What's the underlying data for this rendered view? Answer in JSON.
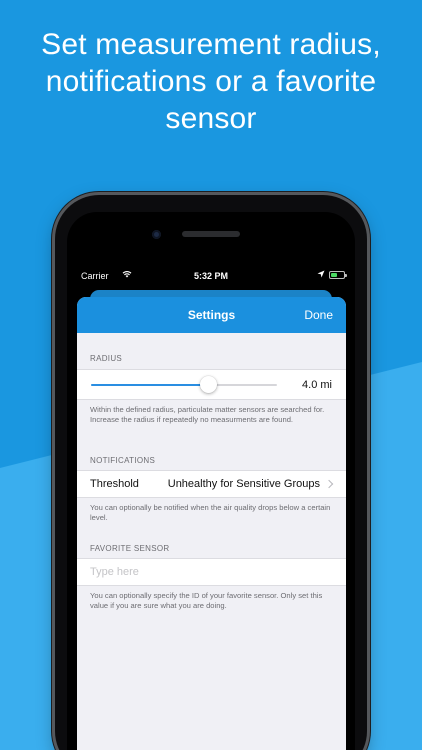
{
  "headline": {
    "line1": "Set measurement radius,",
    "line2": "notifications or a favorite",
    "line3": "sensor"
  },
  "status_bar": {
    "carrier": "Carrier",
    "time": "5:32 PM",
    "icons": [
      "wifi-icon",
      "location-icon",
      "battery-icon"
    ]
  },
  "navbar": {
    "title": "Settings",
    "done_label": "Done"
  },
  "radius": {
    "header": "RADIUS",
    "slider_fraction": 0.63,
    "value": "4.0 mi",
    "footer": "Within the defined radius, particulate matter sensors are searched for. Increase the radius if repeatedly no measurments are found."
  },
  "notifications": {
    "header": "NOTIFICATIONS",
    "threshold_label": "Threshold",
    "threshold_value": "Unhealthy for Sensitive Groups",
    "footer": "You can optionally be notified when the air quality drops below a certain level."
  },
  "favorite_sensor": {
    "header": "FAVORITE SENSOR",
    "placeholder": "Type here",
    "value": "",
    "footer": "You can optionally specify the ID of your favorite sensor. Only set this value if you are sure what you are doing."
  },
  "colors": {
    "background_dark": "#1a97e0",
    "background_light": "#3aaeee",
    "navbar": "#1b90de",
    "slider_fill": "#2a8ee2"
  }
}
